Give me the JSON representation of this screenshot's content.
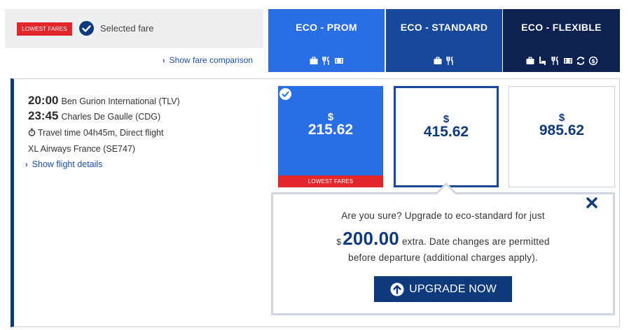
{
  "legend": {
    "badge_text": "LOWEST FARES",
    "selected_label": "Selected fare",
    "compare_link": "Show fare comparison"
  },
  "tabs": [
    {
      "title": "ECO - PROM",
      "icons": [
        "baggage-icon",
        "meal-icon",
        "entertainment-icon"
      ]
    },
    {
      "title": "ECO - STANDARD",
      "icons": [
        "baggage-icon",
        "meal-icon"
      ]
    },
    {
      "title": "ECO - FLEXIBLE",
      "icons": [
        "baggage-icon",
        "seat-icon",
        "meal-icon",
        "entertainment-icon",
        "change-icon",
        "refund-icon"
      ]
    }
  ],
  "flight": {
    "departure_time": "20:00",
    "departure_airport": "Ben Gurion International (TLV)",
    "arrival_time": "23:45",
    "arrival_airport": "Charles De Gaulle (CDG)",
    "travel_time_label": "Travel time 04h45m,",
    "flight_type": "Direct flight",
    "airline": "XL Airways France (SE747)",
    "details_link": "Show flight details"
  },
  "fares": [
    {
      "currency": "$",
      "amount": "215.62",
      "selected": true,
      "badge": "LOWEST FARES"
    },
    {
      "currency": "$",
      "amount": "415.62",
      "selected": false
    },
    {
      "currency": "$",
      "amount": "985.62",
      "selected": false
    }
  ],
  "popup": {
    "line1": "Are you sure? Upgrade to eco-standard for just",
    "currency": "$",
    "amount": "200.00",
    "line2_rest": "extra. Date changes are permitted",
    "line3": "before departure (additional charges apply).",
    "button_label": "UPGRADE NOW"
  },
  "colors": {
    "prom": "#2a6ee6",
    "standard": "#18489c",
    "flexible": "#0d2250",
    "navy": "#0e3a7c",
    "badge_red": "#e3262b"
  }
}
